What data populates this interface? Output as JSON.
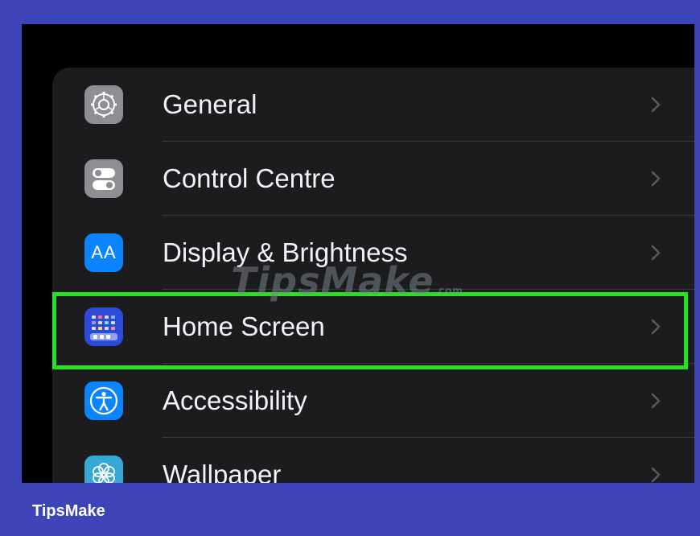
{
  "settings": {
    "items": [
      {
        "label": "General",
        "icon": "gear-icon",
        "color": "#8e8e93"
      },
      {
        "label": "Control Centre",
        "icon": "toggles-icon",
        "color": "#8e8e93"
      },
      {
        "label": "Display & Brightness",
        "icon": "text-size-icon",
        "color": "#0a84ff",
        "icon_text": "AA"
      },
      {
        "label": "Home Screen",
        "icon": "home-grid-icon",
        "color": "#2c4bd8",
        "highlighted": true
      },
      {
        "label": "Accessibility",
        "icon": "accessibility-icon",
        "color": "#0a84ff"
      },
      {
        "label": "Wallpaper",
        "icon": "flower-icon",
        "color": "#37a7d6"
      }
    ]
  },
  "watermark": {
    "text": "TipsMake",
    "suffix": ".com"
  },
  "footer": {
    "brand": "TipsMake"
  },
  "colors": {
    "highlight": "#27e21f",
    "frame": "#3d44b8",
    "panel": "#1c1c1e"
  }
}
